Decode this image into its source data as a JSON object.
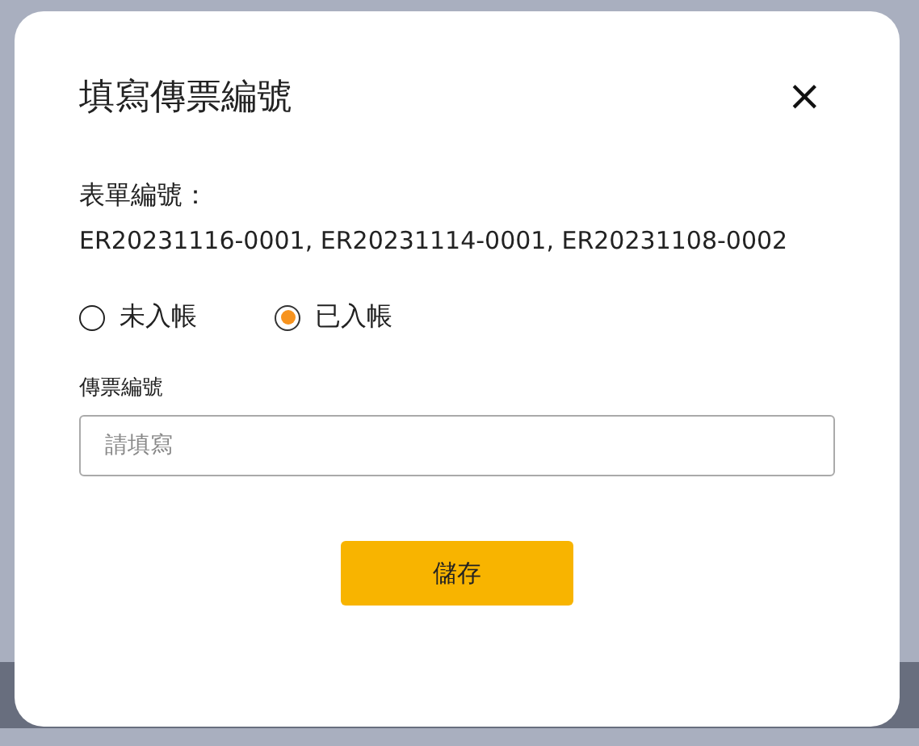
{
  "dialog": {
    "title": "填寫傳票編號",
    "close_icon": "×"
  },
  "form_numbers": {
    "label": "表單編號：",
    "value": "ER20231116-0001, ER20231114-0001, ER20231108-0002"
  },
  "posting_status": [
    {
      "label": "未入帳",
      "selected": false
    },
    {
      "label": "已入帳",
      "selected": true
    }
  ],
  "voucher_field": {
    "label": "傳票編號",
    "placeholder": "請填寫"
  },
  "save_button": "儲存"
}
